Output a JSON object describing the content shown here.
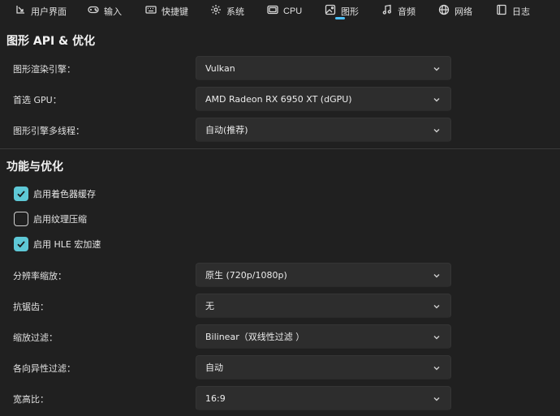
{
  "tabs": [
    {
      "label": "用户界面",
      "icon": "user-interface-icon"
    },
    {
      "label": "输入",
      "icon": "gamepad-icon"
    },
    {
      "label": "快捷键",
      "icon": "keyboard-icon"
    },
    {
      "label": "系统",
      "icon": "gear-icon"
    },
    {
      "label": "CPU",
      "icon": "cpu-icon"
    },
    {
      "label": "图形",
      "icon": "image-icon",
      "active": true
    },
    {
      "label": "音频",
      "icon": "music-note-icon"
    },
    {
      "label": "网络",
      "icon": "globe-icon"
    },
    {
      "label": "日志",
      "icon": "log-icon"
    }
  ],
  "accent": "#4cc2ff",
  "checkbox_color": "#5ec8d6",
  "graphics_api": {
    "title": "图形 API & 优化",
    "backend": {
      "label": "图形渲染引擎：",
      "value": "Vulkan"
    },
    "gpu": {
      "label": "首选 GPU：",
      "value": "AMD Radeon RX 6950 XT (dGPU)"
    },
    "threading": {
      "label": "图形引擎多线程：",
      "value": "自动(推荐)"
    }
  },
  "features": {
    "title": "功能与优化",
    "checkboxes": [
      {
        "label": "启用着色器缓存",
        "checked": true
      },
      {
        "label": "启用纹理压缩",
        "checked": false
      },
      {
        "label": "启用 HLE 宏加速",
        "checked": true
      }
    ],
    "resolution": {
      "label": "分辨率缩放：",
      "value": "原生 (720p/1080p)"
    },
    "antialiasing": {
      "label": "抗锯齿：",
      "value": "无"
    },
    "scaling_filter": {
      "label": "缩放过滤：",
      "value": "Bilinear（双线性过滤 ）"
    },
    "anisotropic": {
      "label": "各向异性过滤：",
      "value": "自动"
    },
    "aspect_ratio": {
      "label": "宽高比：",
      "value": "16:9"
    }
  }
}
